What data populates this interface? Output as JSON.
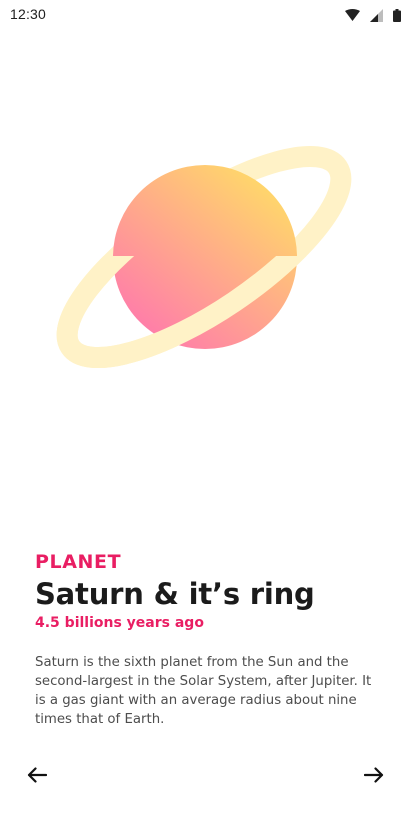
{
  "status_bar": {
    "time": "12:30",
    "icons": [
      "wifi-icon",
      "cellular-signal-icon",
      "battery-icon"
    ]
  },
  "illustration": {
    "subject": "saturn-planet-with-ring",
    "colors": {
      "planet_gradient_start": "#ffd86a",
      "planet_gradient_end": "#ff7fa8",
      "ring": "#fff2c7"
    }
  },
  "content": {
    "category": "PLANET",
    "title": "Saturn & it’s ring",
    "age": "4.5 billions years ago",
    "description": "Saturn is the sixth planet from the Sun and the second-largest in the Solar System, after Jupiter. It is a gas giant with an average radius about nine times that of Earth."
  },
  "navigation": {
    "prev_icon": "arrow-left-icon",
    "next_icon": "arrow-right-icon"
  },
  "colors": {
    "accent": "#e91e63",
    "title": "#1b1b1b",
    "body_text": "#4d4d4d",
    "background": "#ffffff"
  }
}
